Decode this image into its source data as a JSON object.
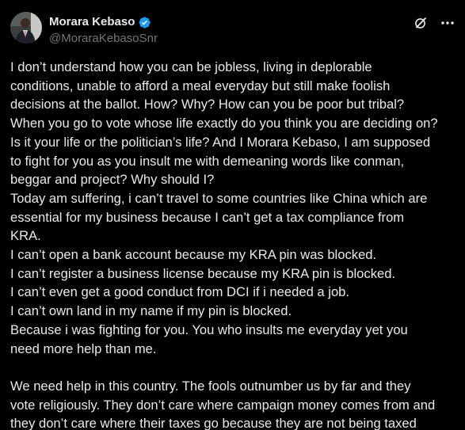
{
  "author": {
    "display_name": "Morara Kebaso",
    "handle": "@MoraraKebasoSnr",
    "verified": true,
    "avatar_icon": "profile-photo"
  },
  "actions": {
    "grok_icon": "grok-icon",
    "more_icon": "more-icon"
  },
  "colors": {
    "background": "#000000",
    "text": "#e7e9ea",
    "muted": "#71767b",
    "verified_blue": "#1d9bf0"
  },
  "tweet": {
    "lines": [
      "I don’t understand how you can be jobless, living in deplorable",
      "conditions, unable to afford a meal everyday but still make foolish",
      "decisions at the ballot. How? Why? How can you be poor but tribal?",
      "When you go to vote whose life exactly do you think you are deciding on?",
      "Is it your life or the politician’s life? And I Morara Kebaso, I am supposed",
      "to fight for you as you insult me with demeaning words like conman,",
      "beggar and project? Why should I?",
      "Today am suffering, i can’t travel to some countries like China which are",
      "essential for my business because I can’t get a tax compliance from",
      "KRA.",
      "I can’t open a bank account because my KRA pin was blocked.",
      "I can’t register a business license because my KRA pin is blocked.",
      "I can’t even get a good conduct from DCI if i needed a job.",
      "I can’t own land in my name if my pin is blocked.",
      "Because i was fighting for you. You who insults me everyday yet you",
      "need more help than me.",
      "",
      "We need help in this country. The fools outnumber us by far and they",
      "vote religiously. They don’t care where campaign money comes from and",
      "they don’t care where their taxes go because they are not being taxed"
    ]
  }
}
